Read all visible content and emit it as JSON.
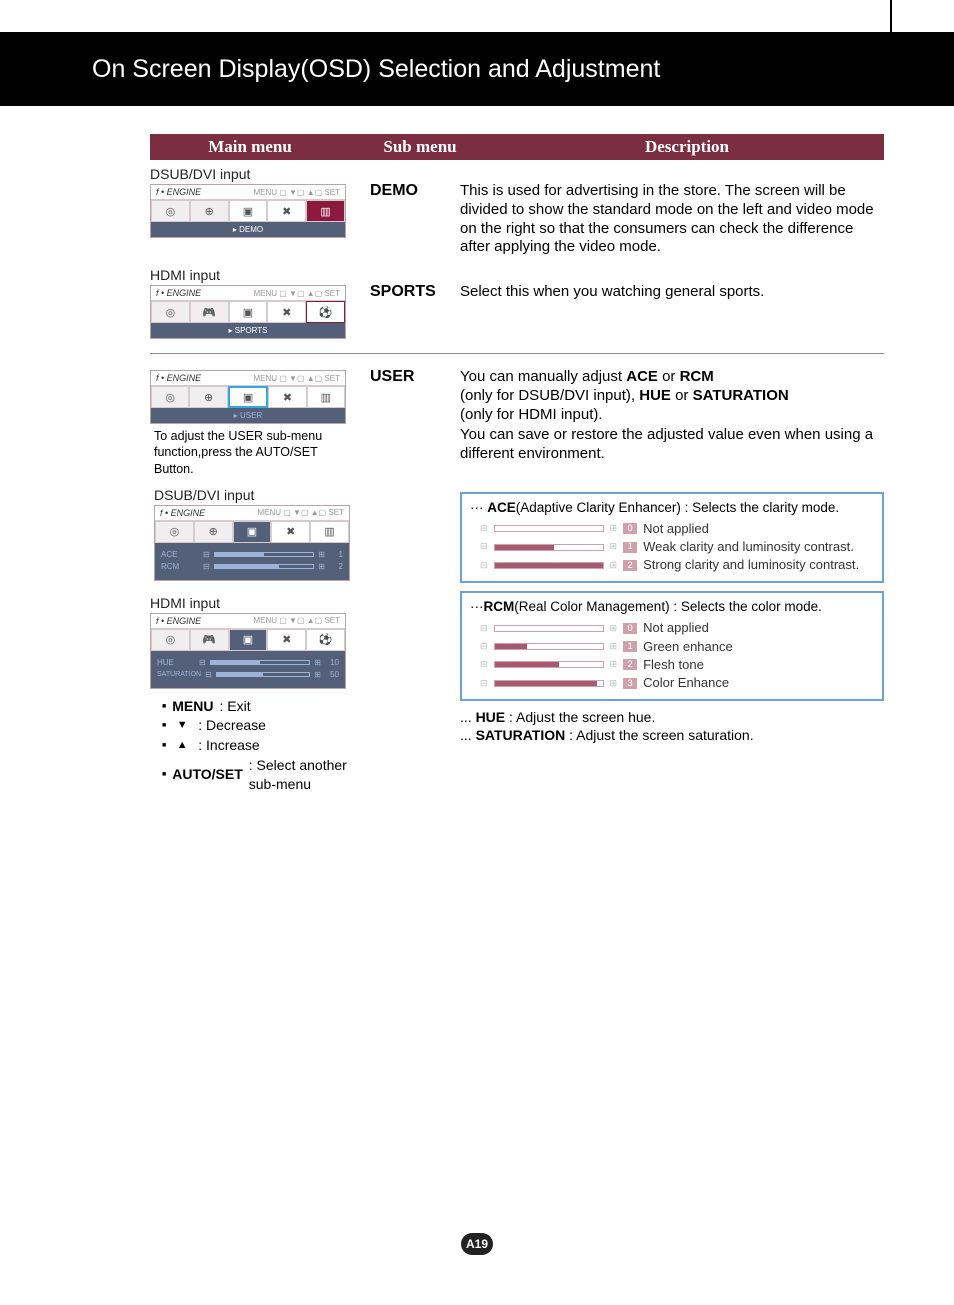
{
  "banner_title": "On Screen Display(OSD) Selection and Adjustment",
  "cols": {
    "main": "Main menu",
    "sub": "Sub menu",
    "desc": "Description"
  },
  "label_dsub": "DSUB/DVI input",
  "label_hdmi": "HDMI input",
  "osd": {
    "engine": "f • ENGINE",
    "nav": "MENU ▢  ▼▢  ▲▢  SET",
    "demo": "▸ DEMO",
    "sports": "▸ SPORTS",
    "user": "▸ USER",
    "ace": "ACE",
    "rcm": "RCM",
    "hue": "HUE",
    "sat": "SATURATION",
    "v1": "1",
    "v2": "2",
    "v10": "10",
    "v50": "50"
  },
  "sub": {
    "demo": "DEMO",
    "sports": "SPORTS",
    "user": "USER"
  },
  "desc": {
    "demo": "This is used for advertising in the store. The screen will be divided to show the standard mode on the left and video mode on the right so that the consumers can check the difference after applying the video mode.",
    "sports": "Select this when you watching general sports.",
    "user_l1a": "You can manually adjust ",
    "user_l1b": " or ",
    "user_l2a": "(only for DSUB/DVI input), ",
    "user_l2b": " or ",
    "user_l3": "(only for HDMI input).",
    "user_l4": "You can save or restore the adjusted value even when using a different environment.",
    "ace_bold": "ACE",
    "rcm_bold": "RCM",
    "hue_bold": "HUE",
    "sat_bold": "SATURATION"
  },
  "note_user": "To adjust the USER sub-menu function,press the AUTO/SET Button.",
  "ace_box": {
    "title_pre": "··· ",
    "title_bold": "ACE",
    "title_rest": "(Adaptive Clarity Enhancer) : Selects the clarity mode.",
    "opts": [
      {
        "n": "0",
        "label": "Not applied",
        "fill": "0%"
      },
      {
        "n": "1",
        "label": "Weak clarity and luminosity contrast.",
        "fill": "55%"
      },
      {
        "n": "2",
        "label": "Strong clarity and luminosity contrast.",
        "fill": "100%"
      }
    ]
  },
  "rcm_box": {
    "title_pre": "···",
    "title_bold": "RCM",
    "title_rest": "(Real Color Management) : Selects the color mode.",
    "opts": [
      {
        "n": "0",
        "label": "Not applied",
        "fill": "0%"
      },
      {
        "n": "1",
        "label": "Green enhance",
        "fill": "30%"
      },
      {
        "n": "2",
        "label": "Flesh tone",
        "fill": "60%"
      },
      {
        "n": "3",
        "label": "Color Enhance",
        "fill": "95%"
      }
    ]
  },
  "hue_line_pre": "... ",
  "hue_line_bold": "HUE",
  "hue_line_rest": " : Adjust the screen hue.",
  "sat_line_pre": "... ",
  "sat_line_bold": "SATURATION",
  "sat_line_rest": " : Adjust the screen saturation.",
  "legend": {
    "menu_b": "MENU",
    "menu_r": " : Exit",
    "dec": " : Decrease",
    "inc": " : Increase",
    "auto_b": "AUTO/SET",
    "auto_r": " : Select another sub-menu"
  },
  "page_num": "A19"
}
